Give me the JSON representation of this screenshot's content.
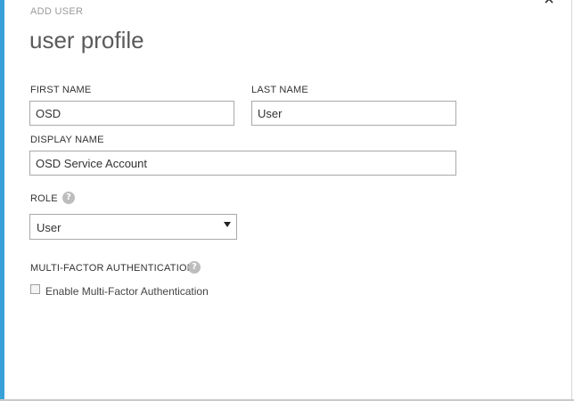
{
  "dialog": {
    "kicker": "ADD USER",
    "title": "user profile"
  },
  "first_name": {
    "label": "FIRST NAME",
    "value": "OSD"
  },
  "last_name": {
    "label": "LAST NAME",
    "value": "User"
  },
  "display_name": {
    "label": "DISPLAY NAME",
    "value": "OSD Service Account"
  },
  "role": {
    "label": "ROLE",
    "selected": "User",
    "help_icon": "question-mark-icon"
  },
  "mfa": {
    "label": "MULTI-FACTOR AUTHENTICATION",
    "help_icon": "question-mark-icon",
    "checkbox_label": "Enable Multi-Factor Authentication",
    "checked": false
  },
  "window": {
    "collapse_icon": "chevron-up-icon"
  },
  "colors": {
    "accent": "#3aa1d8",
    "title": "#5a5a5a",
    "field_border": "#a9a9a9"
  }
}
